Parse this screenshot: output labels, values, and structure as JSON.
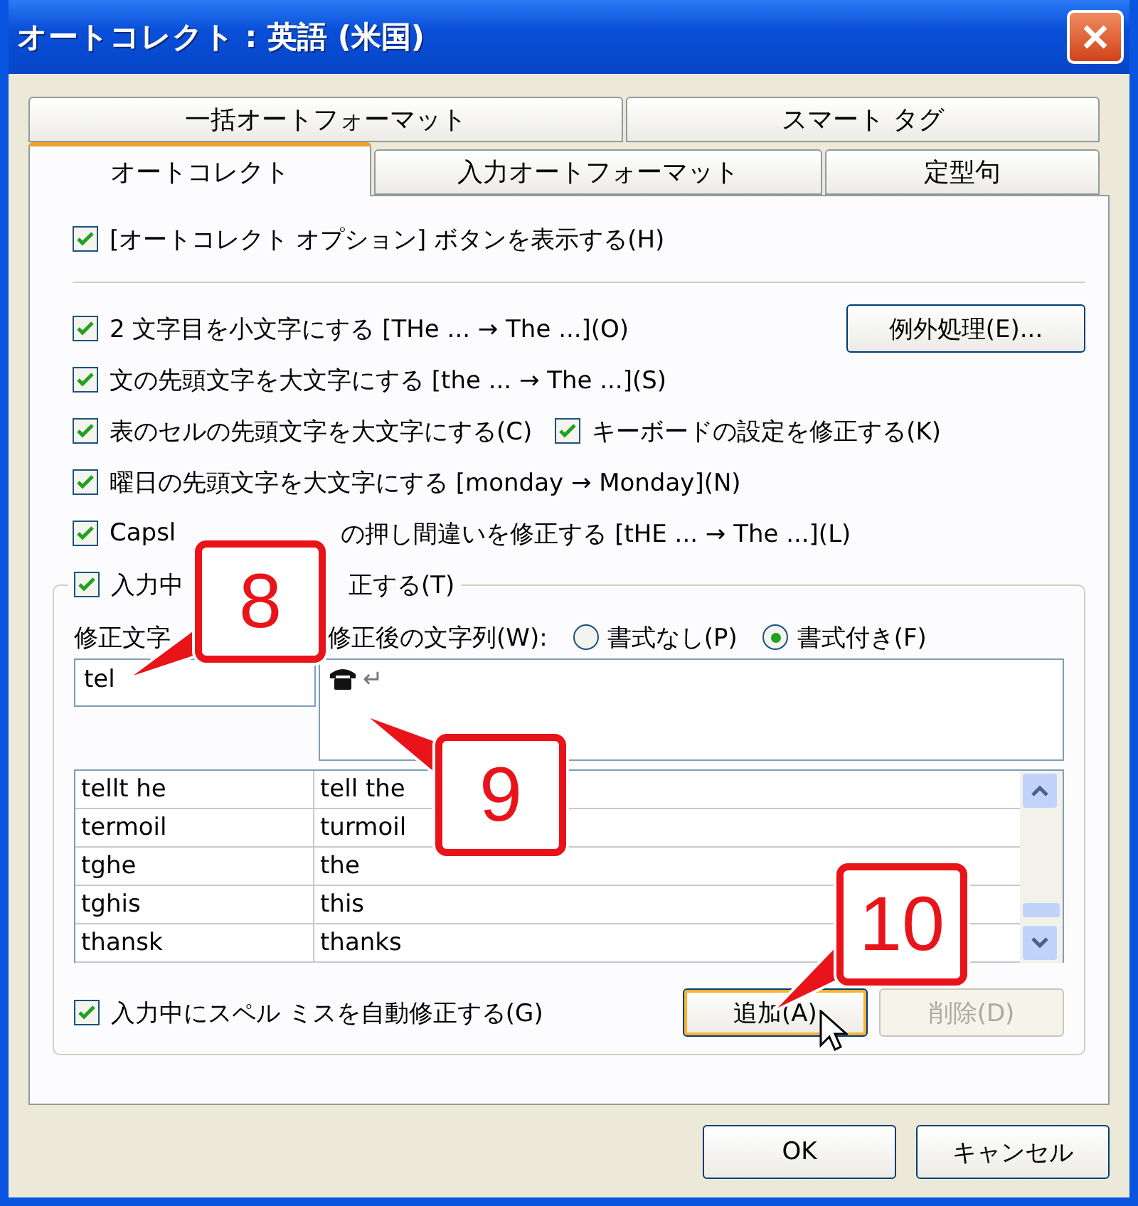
{
  "window": {
    "title": "オートコレクト : 英語 (米国)"
  },
  "tabs": [
    [
      {
        "label": "一括オートフォーマット",
        "selected": false
      },
      {
        "label": "スマート タグ",
        "selected": false
      }
    ],
    [
      {
        "label": "オートコレクト",
        "selected": true
      },
      {
        "label": "入力オートフォーマット",
        "selected": false
      },
      {
        "label": "定型句",
        "selected": false
      }
    ]
  ],
  "show_options_button": {
    "label": "[オートコレクト オプション] ボタンを表示する(H)",
    "checked": true
  },
  "options": [
    {
      "parts": [
        "2 文字目を小文字にする [THe ... → The ...](O)"
      ],
      "checked": true,
      "button": "例外処理(E)..."
    },
    {
      "parts": [
        "文の先頭文字を大文字にする [the ... → The ...](S)"
      ],
      "checked": true
    },
    {
      "parts": [
        "表のセルの先頭文字を大文字にする(C)"
      ],
      "checked": true,
      "extra": {
        "label": "キーボードの設定を修正する(K)",
        "checked": true
      }
    },
    {
      "parts": [
        "曜日の先頭文字を大文字にする [monday → Monday](N)"
      ],
      "checked": true
    },
    {
      "parts": [
        "Capsl",
        "の押し間違いを修正する [tHE ... → The ...](L)"
      ],
      "checked": true
    }
  ],
  "replace_group": {
    "legend_parts": [
      "入力中",
      "正する(T)"
    ],
    "checked": true,
    "replace_label": "修正文字",
    "with_label": "修正後の文字列(W):",
    "radios": [
      {
        "label": "書式なし(P)",
        "selected": false
      },
      {
        "label": "書式付き(F)",
        "selected": true
      }
    ],
    "replace_value": "tel",
    "with_value": "↵",
    "entries": [
      [
        "tellt he",
        "tell the"
      ],
      [
        "termoil",
        "turmoil"
      ],
      [
        "tghe",
        "the"
      ],
      [
        "tghis",
        "this"
      ],
      [
        "thansk",
        "thanks"
      ]
    ],
    "auto_spell": {
      "label": "入力中にスペル ミスを自動修正する(G)",
      "checked": true
    },
    "add_button": {
      "label": "追加(A)",
      "disabled": false
    },
    "delete_button": {
      "label": "削除(D)",
      "disabled": true
    }
  },
  "buttons": [
    "OK",
    "キャンセル"
  ],
  "callouts": [
    "8",
    "9",
    "10"
  ]
}
